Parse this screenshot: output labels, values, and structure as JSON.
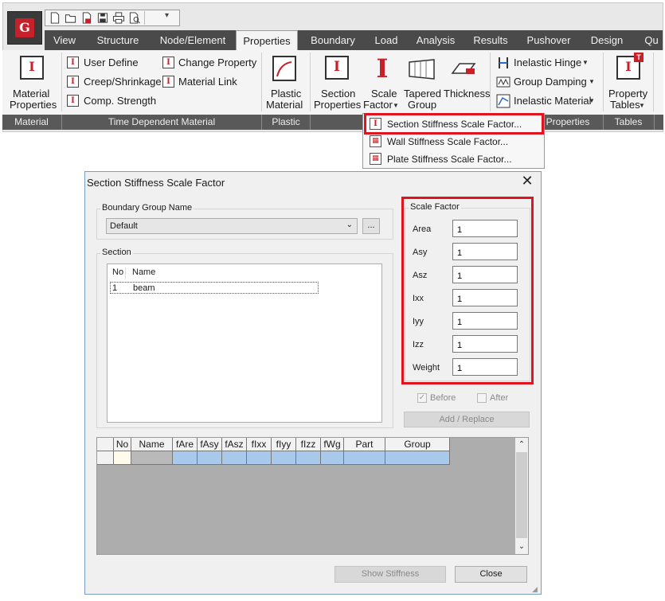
{
  "ribbon": {
    "tabs": [
      "View",
      "Structure",
      "Node/Element",
      "Properties",
      "Boundary",
      "Load",
      "Analysis",
      "Results",
      "Pushover",
      "Design",
      "Qu"
    ],
    "active_tab": "Properties",
    "material": {
      "line1": "Material",
      "line2": "Properties",
      "group": "Material"
    },
    "time_dependent": {
      "user_define": "User Define",
      "creep": "Creep/Shrinkage",
      "comp_strength": "Comp. Strength",
      "change_property": "Change Property",
      "material_link": "Material Link",
      "group": "Time Dependent Material"
    },
    "plastic": {
      "line1": "Plastic",
      "line2": "Material",
      "group": "Plastic"
    },
    "section": {
      "section_props_l1": "Section",
      "section_props_l2": "Properties",
      "scale_factor_l1": "Scale",
      "scale_factor_l2": "Factor",
      "tapered_l1": "Tapered",
      "tapered_l2": "Group",
      "thickness": "Thickness",
      "group_suffix": "Properties"
    },
    "inelastic": {
      "hinge": "Inelastic Hinge",
      "damping": "Group Damping",
      "material": "Inelastic Material"
    },
    "tables": {
      "line1": "Property",
      "line2": "Tables",
      "group": "Tables"
    }
  },
  "scale_factor_menu": {
    "items": [
      "Section Stiffness Scale Factor...",
      "Wall Stiffness Scale Factor...",
      "Plate Stiffness Scale Factor..."
    ]
  },
  "dialog": {
    "title": "Section Stiffness Scale Factor",
    "close_glyph": "✕",
    "boundary_group": {
      "legend": "Boundary Group Name",
      "value": "Default",
      "browse_label": "..."
    },
    "section": {
      "legend": "Section",
      "columns": [
        "No",
        "Name"
      ],
      "rows": [
        {
          "no": "1",
          "name": "beam"
        }
      ]
    },
    "scale_factor": {
      "legend": "Scale Factor",
      "fields": [
        {
          "label": "Area",
          "value": "1"
        },
        {
          "label": "Asy",
          "value": "1"
        },
        {
          "label": "Asz",
          "value": "1"
        },
        {
          "label": "Ixx",
          "value": "1"
        },
        {
          "label": "Iyy",
          "value": "1"
        },
        {
          "label": "Izz",
          "value": "1"
        },
        {
          "label": "Weight",
          "value": "1"
        }
      ]
    },
    "before_label": "Before",
    "before_checked": true,
    "after_label": "After",
    "after_checked": false,
    "add_replace_label": "Add / Replace",
    "table_columns": [
      "No",
      "Name",
      "fAre",
      "fAsy",
      "fAsz",
      "fIxx",
      "fIyy",
      "fIzz",
      "fWg",
      "Part",
      "Group"
    ],
    "show_stiffness_label": "Show Stiffness",
    "close_label": "Close"
  },
  "colors": {
    "highlight_red": "#e0141e",
    "tab_bar": "#4a4a4a",
    "group_bar": "#595959",
    "grid_selected": "#a9c9ec"
  }
}
